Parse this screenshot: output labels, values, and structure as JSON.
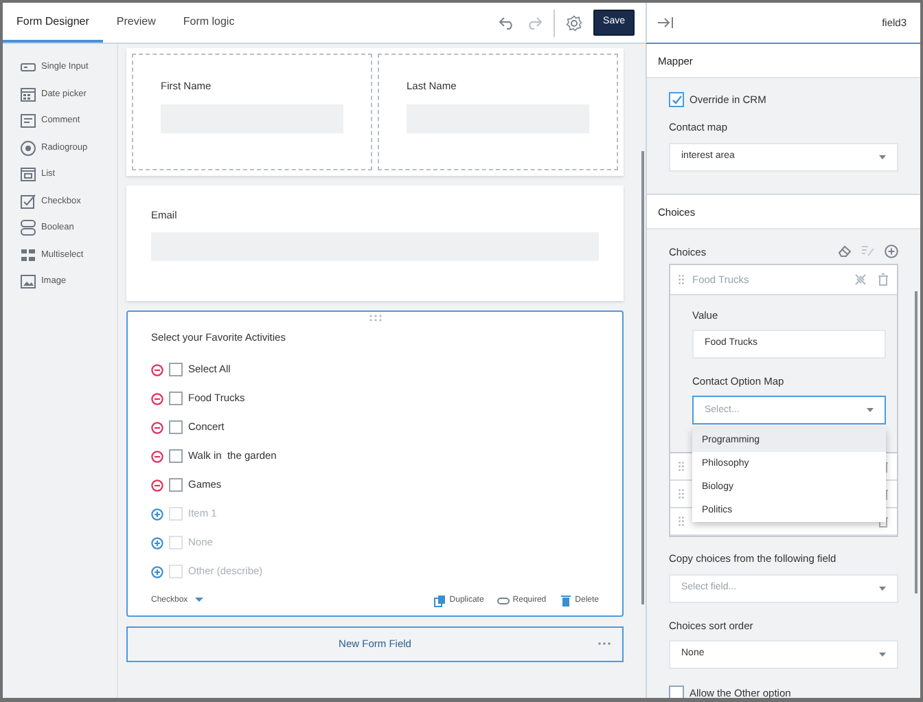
{
  "tabs": [
    {
      "label": "Form Designer",
      "selected": true
    },
    {
      "label": "Preview",
      "selected": false
    },
    {
      "label": "Form logic",
      "selected": false
    }
  ],
  "toolbar": {
    "save": "Save"
  },
  "toolbox": [
    {
      "label": "Single Input",
      "kind": "input"
    },
    {
      "label": "Date picker",
      "kind": "date"
    },
    {
      "label": "Comment",
      "kind": "comment"
    },
    {
      "label": "Radiogroup",
      "kind": "radio"
    },
    {
      "label": "List",
      "kind": "list"
    },
    {
      "label": "Checkbox",
      "kind": "checkbox"
    },
    {
      "label": "Boolean",
      "kind": "boolean"
    },
    {
      "label": "Multiselect",
      "kind": "multiselect"
    },
    {
      "label": "Image",
      "kind": "image"
    }
  ],
  "canvas": {
    "name_row": [
      {
        "label": "First Name"
      },
      {
        "label": "Last Name"
      }
    ],
    "email": {
      "label": "Email"
    },
    "question": {
      "title": "Select your Favorite Activities",
      "choices": [
        {
          "label": "Select All",
          "checked": false,
          "disabled": false
        },
        {
          "label": "Food Trucks",
          "checked": false,
          "disabled": false
        },
        {
          "label": "Concert",
          "checked": false,
          "disabled": false
        },
        {
          "label": "Walk in  the garden",
          "checked": false,
          "disabled": false
        },
        {
          "label": "Games",
          "checked": false,
          "disabled": false
        },
        {
          "label": "Item 1",
          "checked": false,
          "disabled": true
        },
        {
          "label": "None",
          "checked": false,
          "disabled": true
        },
        {
          "label": "Other (describe)",
          "checked": false,
          "disabled": true
        }
      ],
      "type": "Checkbox",
      "actions": [
        {
          "label": "Duplicate",
          "kind": "duplicate"
        },
        {
          "label": "Required",
          "kind": "required"
        },
        {
          "label": "Delete",
          "kind": "delete"
        }
      ]
    },
    "new_field": "New Form Field"
  },
  "panel": {
    "field_name": "field3",
    "mapper": {
      "title": "Mapper",
      "override": {
        "label": "Override in CRM",
        "checked": true
      },
      "contact_map": {
        "label": "Contact map",
        "value": "interest area"
      }
    },
    "choices": {
      "title": "Choices",
      "label": "Choices",
      "items": [
        {
          "label": "Food Trucks",
          "expanded": true,
          "value_label": "Value",
          "value": "Food Trucks",
          "option_map_label": "Contact Option Map",
          "option_map_placeholder": "Select...",
          "options": [
            {
              "label": "Programming",
              "selected": true
            },
            {
              "label": "Philosophy",
              "selected": false
            },
            {
              "label": "Biology",
              "selected": false
            },
            {
              "label": "Politics",
              "selected": false
            }
          ]
        },
        {
          "expanded": false
        },
        {
          "expanded": false
        },
        {
          "expanded": false
        }
      ],
      "copy": {
        "label": "Copy choices from the following field",
        "placeholder": "Select field..."
      },
      "sort": {
        "label": "Choices sort order",
        "value": "None"
      },
      "allow_other": {
        "label": "Allow the Other option",
        "checked": false
      }
    }
  }
}
